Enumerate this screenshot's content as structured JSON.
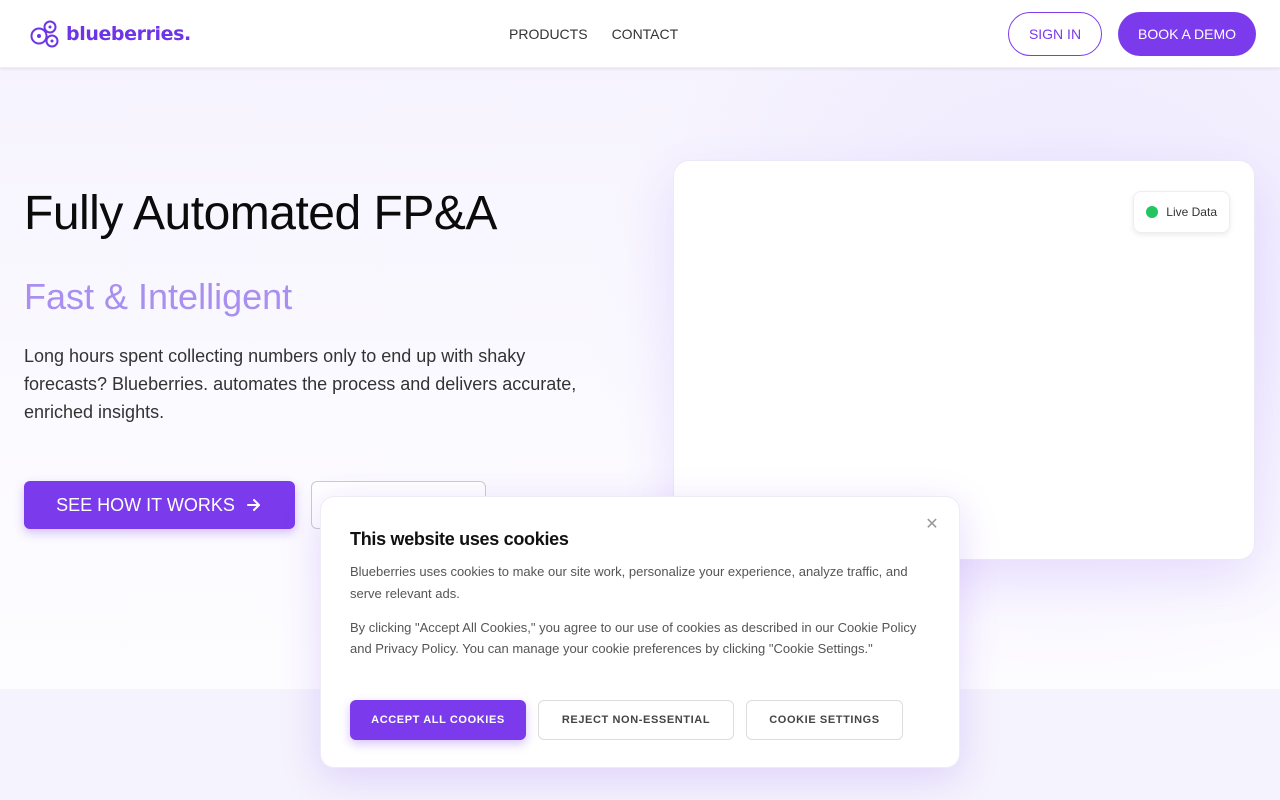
{
  "header": {
    "logo_text": "blueberries.",
    "nav": [
      "PRODUCTS",
      "CONTACT"
    ],
    "sign_in": "SIGN IN",
    "book_demo": "BOOK A DEMO"
  },
  "hero": {
    "title": "Fully Automated FP&A",
    "subtitle": "Fast & Intelligent",
    "description": "Long hours spent collecting numbers only to end up with shaky forecasts? Blueberries. automates the process and delivers accurate, enriched insights.",
    "cta_primary": "SEE HOW IT WORKS",
    "cta_primary_icon": "arrow-right-icon"
  },
  "card": {
    "badge": "Live Data"
  },
  "cookie": {
    "title": "This website uses cookies",
    "paragraph1": "Blueberries uses cookies to make our site work, personalize your experience, analyze traffic, and serve relevant ads.",
    "paragraph2": "By clicking \"Accept All Cookies,\" you agree to our use of cookies as described in our Cookie Policy and Privacy Policy. You can manage your cookie preferences by clicking \"Cookie Settings.\"",
    "accept": "ACCEPT ALL COOKIES",
    "reject": "REJECT NON-ESSENTIAL",
    "settings": "COOKIE SETTINGS",
    "close_icon": "close-icon"
  },
  "colors": {
    "brand": "#7c3aed",
    "subtitle": "#a98ff0",
    "live": "#22c55e"
  }
}
